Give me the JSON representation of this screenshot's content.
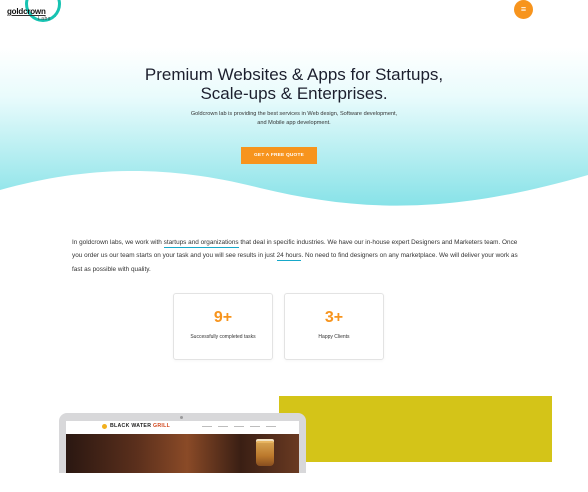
{
  "header": {
    "logo": {
      "name": "goldcrown",
      "sub": "Labs"
    },
    "menu_icon": "menu-icon"
  },
  "hero": {
    "title_line1": "Premium Websites & Apps for Startups,",
    "title_line2": "Scale-ups & Enterprises.",
    "subtitle_line1": "Goldcrown lab is providing the best services in Web design, Software development,",
    "subtitle_line2": "and Mobile app development.",
    "cta_label": "GET A FREE QUOTE"
  },
  "intro": {
    "t1": "In goldcrown labs, we work with ",
    "h1": "startups and organizations",
    "t2": " that deal in specific industries. We have our in-house expert Designers and Marketers team. Once you order us our team starts on your task and you will see results in just ",
    "h2": "24 hours",
    "t3": ". No need to find designers on any marketplace. We will deliver your work as fast as possible with quality."
  },
  "stats": [
    {
      "value": "9+",
      "label": "Successfully completed tasks"
    },
    {
      "value": "3+",
      "label": "Happy Clients"
    }
  ],
  "showcase": {
    "site_logo_main": "BLACK WATER",
    "site_logo_accent": "GRILL"
  },
  "colors": {
    "accent": "#f7941d",
    "teal": "#17c3b2",
    "hero_gradient_end": "#7fe0e6",
    "yellow": "#d4c418"
  }
}
